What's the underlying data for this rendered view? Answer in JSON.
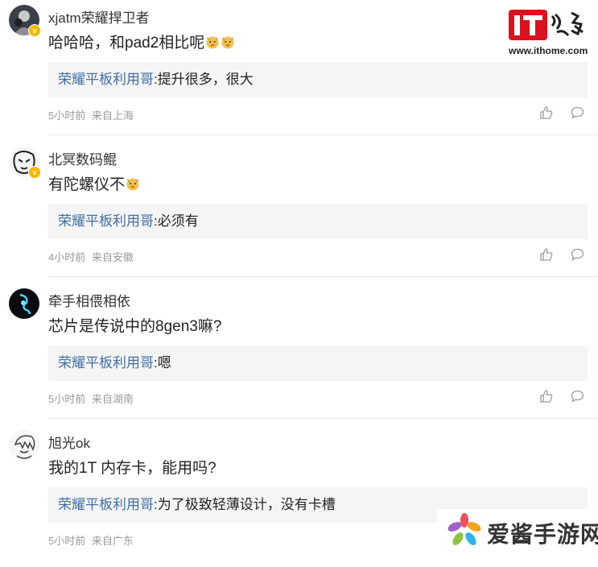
{
  "brand": {
    "site_url": "www.ithome.com",
    "logo_text": "IT之家",
    "accent": "#d9121b"
  },
  "watermark": {
    "text": "爱酱手游网"
  },
  "colors": {
    "reply_user": "#3e6fa6",
    "meta": "#999999",
    "reply_bg": "#f5f5f5"
  },
  "comments": [
    {
      "username": "xjatm荣耀捍卫者",
      "content": "哈哈哈，和pad2相比呢",
      "emoji": "doge-emoji",
      "verified": true,
      "reply_user": "荣耀平板利用哥",
      "reply_text": ":提升很多，很大",
      "time": "5小时前",
      "location": "来自上海",
      "avatar": "avatar-dark-figure"
    },
    {
      "username": "北冥数码鲲",
      "content": "有陀螺仪不",
      "emoji": "doge-emoji",
      "verified": true,
      "reply_user": "荣耀平板利用哥",
      "reply_text": ":必须有",
      "time": "4小时前",
      "location": "来自安徽",
      "avatar": "avatar-sketch"
    },
    {
      "username": "牵手相偎相依",
      "content": "芯片是传说中的8gen3嘛?",
      "emoji": "",
      "verified": false,
      "reply_user": "荣耀平板利用哥",
      "reply_text": ":嗯",
      "time": "5小时前",
      "location": "来自湖南",
      "avatar": "avatar-blue-glow"
    },
    {
      "username": "旭光ok",
      "content": "我的1T 内存卡，能用吗?",
      "emoji": "",
      "verified": false,
      "reply_user": "荣耀平板利用哥",
      "reply_text": ":为了极致轻薄设计，没有卡槽",
      "time": "5小时前",
      "location": "来自广东",
      "avatar": "avatar-anime-sketch"
    }
  ]
}
